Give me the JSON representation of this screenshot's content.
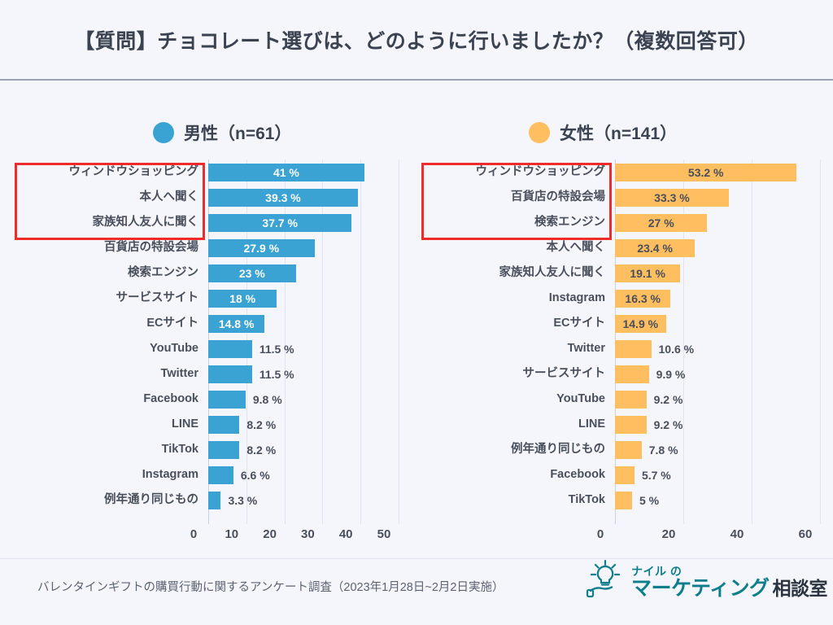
{
  "header": {
    "title": "【質問】チョコレート選びは、どのように行いましたか？（複数回答可）"
  },
  "legends": {
    "male": {
      "label": "男性（n=61）",
      "color": "#3ba3d4",
      "dot_icon": "legend-dot-icon"
    },
    "female": {
      "label": "女性（n=141）",
      "color": "#ffbe60",
      "dot_icon": "legend-dot-icon"
    }
  },
  "footer": {
    "note": "バレンタインギフトの購買行動に関するアンケート調査（2023年1月28日~2月2日実施）",
    "logo_top": "ナイル の",
    "logo_main": "マーケティング",
    "logo_sub": "相談室",
    "logo_icon": "lightbulb-on-hand-icon"
  },
  "chart_data": [
    {
      "type": "bar",
      "orientation": "horizontal",
      "title": "男性（n=61）",
      "series_name": "男性",
      "color": "#3ba3d4",
      "xlabel": "",
      "ylabel": "",
      "xlim": [
        0,
        50
      ],
      "xticks": [
        "0",
        "10",
        "20",
        "30",
        "40",
        "50"
      ],
      "grid": true,
      "legend_position": "top",
      "n": 61,
      "categories": [
        "ウィンドウショッピング",
        "本人へ聞く",
        "家族知人友人に聞く",
        "百貨店の特設会場",
        "検索エンジン",
        "サービスサイト",
        "ECサイト",
        "YouTube",
        "Twitter",
        "Facebook",
        "LINE",
        "TikTok",
        "Instagram",
        "例年通り同じもの"
      ],
      "values": [
        41,
        39.3,
        37.7,
        27.9,
        23,
        18,
        14.8,
        11.5,
        11.5,
        9.8,
        8.2,
        8.2,
        6.6,
        3.3
      ],
      "value_labels": [
        "41 %",
        "39.3 %",
        "37.7 %",
        "27.9 %",
        "23 %",
        "18 %",
        "14.8 %",
        "11.5 %",
        "11.5 %",
        "9.8 %",
        "8.2 %",
        "8.2 %",
        "6.6 %",
        "3.3 %"
      ],
      "label_inside": [
        true,
        true,
        true,
        true,
        true,
        true,
        true,
        false,
        false,
        false,
        false,
        false,
        false,
        false
      ],
      "highlighted": [
        true,
        true,
        true,
        false,
        false,
        false,
        false,
        false,
        false,
        false,
        false,
        false,
        false,
        false
      ],
      "highlight_color": "#ef2b2b"
    },
    {
      "type": "bar",
      "orientation": "horizontal",
      "title": "女性（n=141）",
      "series_name": "女性",
      "color": "#ffbe60",
      "xlabel": "",
      "ylabel": "",
      "xlim": [
        0,
        60
      ],
      "xticks": [
        "0",
        "20",
        "40",
        "60"
      ],
      "grid": true,
      "legend_position": "top",
      "n": 141,
      "categories": [
        "ウィンドウショッピング",
        "百貨店の特設会場",
        "検索エンジン",
        "本人へ聞く",
        "家族知人友人に聞く",
        "Instagram",
        "ECサイト",
        "Twitter",
        "サービスサイト",
        "YouTube",
        "LINE",
        "例年通り同じもの",
        "Facebook",
        "TikTok"
      ],
      "values": [
        53.2,
        33.3,
        27,
        23.4,
        19.1,
        16.3,
        14.9,
        10.6,
        9.9,
        9.2,
        9.2,
        7.8,
        5.7,
        5
      ],
      "value_labels": [
        "53.2 %",
        "33.3 %",
        "27 %",
        "23.4 %",
        "19.1 %",
        "16.3  %",
        "14.9 %",
        "10.6 %",
        "9.9 %",
        "9.2 %",
        "9.2 %",
        "7.8 %",
        "5.7 %",
        "5 %"
      ],
      "label_inside": [
        true,
        true,
        true,
        true,
        true,
        true,
        true,
        false,
        false,
        false,
        false,
        false,
        false,
        false
      ],
      "highlighted": [
        true,
        true,
        true,
        false,
        false,
        false,
        false,
        false,
        false,
        false,
        false,
        false,
        false,
        false
      ],
      "highlight_color": "#ef2b2b"
    }
  ]
}
